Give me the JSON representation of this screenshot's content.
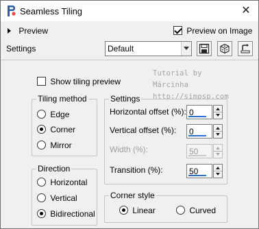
{
  "window": {
    "title": "Seamless Tiling"
  },
  "header": {
    "preview_label": "Preview",
    "preview_on_image": {
      "label": "Preview on Image",
      "checked": true
    }
  },
  "settings": {
    "label": "Settings",
    "selected": "Default"
  },
  "toolbar": {
    "save_icon": "floppy-disk-icon",
    "random_icon": "dice-icon",
    "reset_icon": "reset-arrow-icon"
  },
  "show_tiling_preview": {
    "label": "Show tiling preview",
    "checked": false
  },
  "watermark": {
    "line1": "Tutorial by Márcinha",
    "line2": "http://simpsp.com"
  },
  "tiling_method": {
    "title": "Tiling method",
    "options": [
      {
        "label": "Edge",
        "checked": false
      },
      {
        "label": "Corner",
        "checked": true
      },
      {
        "label": "Mirror",
        "checked": false
      }
    ]
  },
  "direction": {
    "title": "Direction",
    "options": [
      {
        "label": "Horizontal",
        "checked": false
      },
      {
        "label": "Vertical",
        "checked": false
      },
      {
        "label": "Bidirectional",
        "checked": true
      }
    ]
  },
  "params": {
    "title": "Settings",
    "fields": [
      {
        "label": "Horizontal offset (%):",
        "value": "0",
        "enabled": true
      },
      {
        "label": "Vertical offset (%):",
        "value": "0",
        "enabled": true
      },
      {
        "label": "Width (%):",
        "value": "50",
        "enabled": false
      },
      {
        "label": "Transition (%):",
        "value": "50",
        "enabled": true
      }
    ]
  },
  "corner_style": {
    "title": "Corner style",
    "options": [
      {
        "label": "Linear",
        "checked": true
      },
      {
        "label": "Curved",
        "checked": false
      }
    ]
  }
}
